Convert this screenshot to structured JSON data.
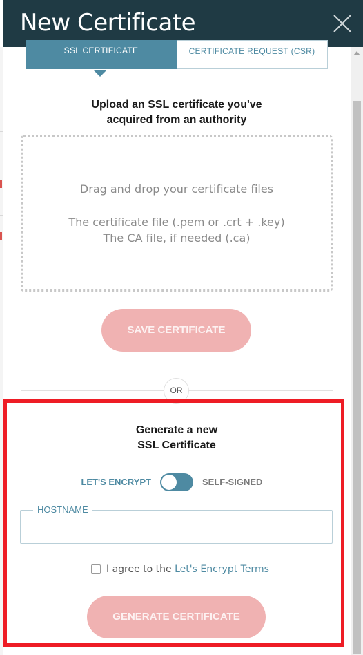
{
  "header": {
    "title": "New Certificate",
    "close_icon": "close-icon"
  },
  "tabs": [
    {
      "label": "SSL CERTIFICATE",
      "active": true
    },
    {
      "label": "CERTIFICATE REQUEST (CSR)",
      "active": false
    }
  ],
  "upload": {
    "heading_line1": "Upload an SSL certificate you've",
    "heading_line2": "acquired from an authority",
    "drop_text": "Drag and drop your certificate files",
    "file_line1": "The certificate file (.pem or .crt + .key)",
    "file_line2": "The CA file, if needed (.ca)",
    "save_label": "SAVE CERTIFICATE"
  },
  "divider": {
    "or_label": "OR"
  },
  "generate": {
    "heading_line1": "Generate a new",
    "heading_line2": "SSL Certificate",
    "toggle_left": "LET'S ENCRYPT",
    "toggle_right": "SELF-SIGNED",
    "hostname_label": "HOSTNAME",
    "hostname_value": "",
    "agree_prefix": "I agree to the ",
    "agree_link": "Let's Encrypt Terms",
    "generate_label": "GENERATE CERTIFICATE"
  },
  "colors": {
    "header_bg": "#1f3a44",
    "accent": "#4e8aa2",
    "button_disabled": "#f0b2b2",
    "highlight": "#ee1c25"
  }
}
